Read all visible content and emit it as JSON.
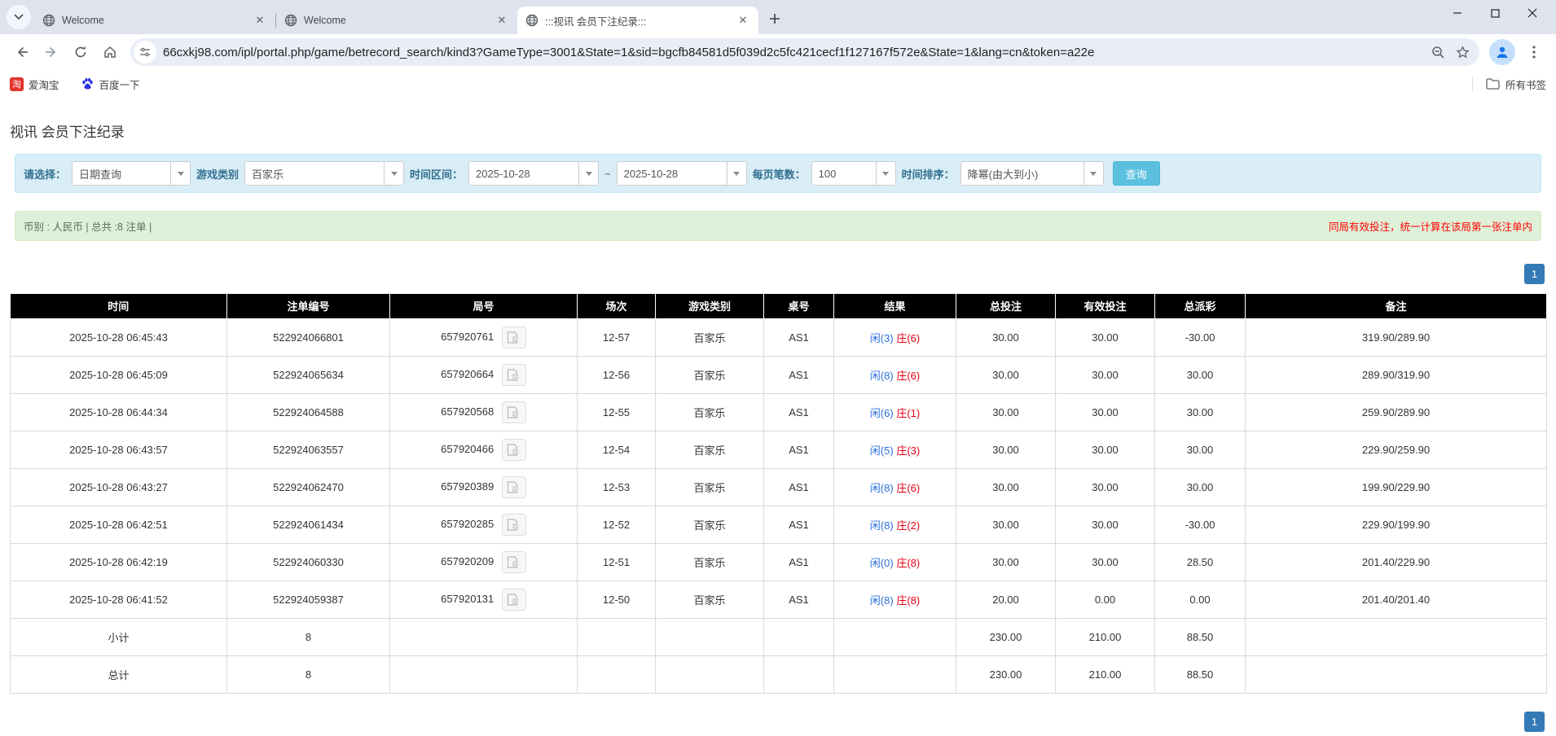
{
  "colors": {
    "accent_blue": "#2a6fdb",
    "banker_red": "#e60012",
    "negative_red": "#ff0000",
    "filter_bg": "#d9edf7",
    "info_bg": "#dff0d8",
    "header_bg": "#000000",
    "summary_bg": "#9d9d9d",
    "pagination_blue": "#337ab7",
    "search_button_bg": "#5bc0de"
  },
  "browser": {
    "tabs": [
      {
        "title": "Welcome",
        "active": false
      },
      {
        "title": "Welcome",
        "active": false
      },
      {
        "title": ":::视讯 会员下注纪录:::",
        "active": true
      }
    ],
    "url": "66cxkj98.com/ipl/portal.php/game/betrecord_search/kind3?GameType=3001&State=1&sid=bgcfb84581d5f039d2c5fc421cecf1f127167f572e&State=1&lang=cn&token=a22e",
    "bookmarks": [
      {
        "label": "爱淘宝",
        "icon": "taobao-icon"
      },
      {
        "label": "百度一下",
        "icon": "baidu-icon"
      }
    ],
    "all_bookmarks_label": "所有书签"
  },
  "page": {
    "title": "视讯 会员下注纪录",
    "filters": {
      "select_label": "请选择：",
      "select_value": "日期查询",
      "game_type_label": "游戏类别",
      "game_type_value": "百家乐",
      "date_range_label": "时间区间：",
      "date_from": "2025-10-28",
      "tilde": "~",
      "date_to": "2025-10-28",
      "per_page_label": "每页笔数：",
      "per_page_value": "100",
      "sort_label": "时间排序：",
      "sort_value": "降幂(由大到小)",
      "search_button": "查询"
    },
    "info_bar": {
      "left": "币别 : 人民币 | 总共 :8 注单 |",
      "right": "同局有效投注，统一计算在该局第一张注单内"
    },
    "pagination": {
      "current": "1"
    },
    "table": {
      "headers": [
        "时间",
        "注单编号",
        "局号",
        "场次",
        "游戏类别",
        "桌号",
        "结果",
        "总投注",
        "有效投注",
        "总派彩",
        "备注"
      ],
      "rows": [
        {
          "time": "2025-10-28 06:45:43",
          "bet_id": "522924066801",
          "round_id": "657920761",
          "session": "12-57",
          "game": "百家乐",
          "table_no": "AS1",
          "result_player": "闲(3)",
          "result_banker": "庄(6)",
          "total_bet": "30.00",
          "valid_bet": "30.00",
          "payout": "-30.00",
          "note": "319.90/289.90"
        },
        {
          "time": "2025-10-28 06:45:09",
          "bet_id": "522924065634",
          "round_id": "657920664",
          "session": "12-56",
          "game": "百家乐",
          "table_no": "AS1",
          "result_player": "闲(8)",
          "result_banker": "庄(6)",
          "total_bet": "30.00",
          "valid_bet": "30.00",
          "payout": "30.00",
          "note": "289.90/319.90"
        },
        {
          "time": "2025-10-28 06:44:34",
          "bet_id": "522924064588",
          "round_id": "657920568",
          "session": "12-55",
          "game": "百家乐",
          "table_no": "AS1",
          "result_player": "闲(6)",
          "result_banker": "庄(1)",
          "total_bet": "30.00",
          "valid_bet": "30.00",
          "payout": "30.00",
          "note": "259.90/289.90"
        },
        {
          "time": "2025-10-28 06:43:57",
          "bet_id": "522924063557",
          "round_id": "657920466",
          "session": "12-54",
          "game": "百家乐",
          "table_no": "AS1",
          "result_player": "闲(5)",
          "result_banker": "庄(3)",
          "total_bet": "30.00",
          "valid_bet": "30.00",
          "payout": "30.00",
          "note": "229.90/259.90"
        },
        {
          "time": "2025-10-28 06:43:27",
          "bet_id": "522924062470",
          "round_id": "657920389",
          "session": "12-53",
          "game": "百家乐",
          "table_no": "AS1",
          "result_player": "闲(8)",
          "result_banker": "庄(6)",
          "total_bet": "30.00",
          "valid_bet": "30.00",
          "payout": "30.00",
          "note": "199.90/229.90"
        },
        {
          "time": "2025-10-28 06:42:51",
          "bet_id": "522924061434",
          "round_id": "657920285",
          "session": "12-52",
          "game": "百家乐",
          "table_no": "AS1",
          "result_player": "闲(8)",
          "result_banker": "庄(2)",
          "total_bet": "30.00",
          "valid_bet": "30.00",
          "payout": "-30.00",
          "note": "229.90/199.90"
        },
        {
          "time": "2025-10-28 06:42:19",
          "bet_id": "522924060330",
          "round_id": "657920209",
          "session": "12-51",
          "game": "百家乐",
          "table_no": "AS1",
          "result_player": "闲(0)",
          "result_banker": "庄(8)",
          "total_bet": "30.00",
          "valid_bet": "30.00",
          "payout": "28.50",
          "note": "201.40/229.90"
        },
        {
          "time": "2025-10-28 06:41:52",
          "bet_id": "522924059387",
          "round_id": "657920131",
          "session": "12-50",
          "game": "百家乐",
          "table_no": "AS1",
          "result_player": "闲(8)",
          "result_banker": "庄(8)",
          "total_bet": "20.00",
          "valid_bet": "0.00",
          "payout": "0.00",
          "note": "201.40/201.40"
        }
      ],
      "subtotal": {
        "label": "小计",
        "count": "8",
        "total_bet": "230.00",
        "valid_bet": "210.00",
        "payout": "88.50"
      },
      "total": {
        "label": "总计",
        "count": "8",
        "total_bet": "230.00",
        "valid_bet": "210.00",
        "payout": "88.50"
      }
    }
  }
}
